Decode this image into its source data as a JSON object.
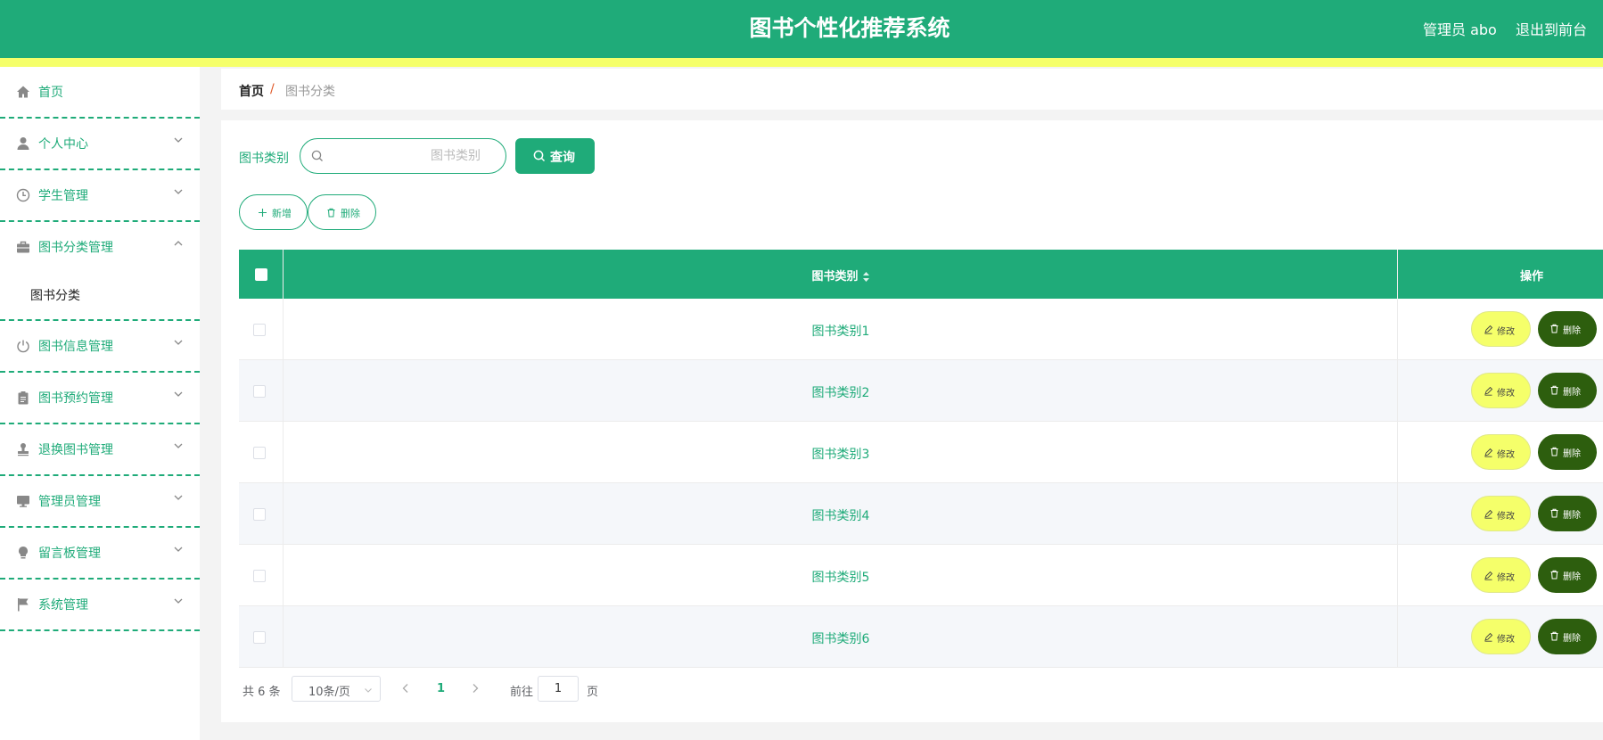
{
  "header": {
    "title": "图书个性化推荐系统",
    "user": "管理员 abo",
    "logout": "退出到前台"
  },
  "sidebar": {
    "items": [
      {
        "label": "首页",
        "icon": "home-icon"
      },
      {
        "label": "个人中心",
        "icon": "user-icon"
      },
      {
        "label": "学生管理",
        "icon": "clock-icon"
      },
      {
        "label": "图书分类管理",
        "icon": "briefcase-icon",
        "expanded": true,
        "children": [
          {
            "label": "图书分类"
          }
        ]
      },
      {
        "label": "图书信息管理",
        "icon": "power-icon"
      },
      {
        "label": "图书预约管理",
        "icon": "clipboard-icon"
      },
      {
        "label": "退换图书管理",
        "icon": "stamp-icon"
      },
      {
        "label": "管理员管理",
        "icon": "monitor-icon"
      },
      {
        "label": "留言板管理",
        "icon": "bulb-icon"
      },
      {
        "label": "系统管理",
        "icon": "flag-icon"
      }
    ]
  },
  "breadcrumb": {
    "home": "首页",
    "separator": "/",
    "current": "图书分类"
  },
  "search": {
    "label": "图书类别",
    "placeholder": "图书类别",
    "value": "",
    "button": "查询"
  },
  "actions": {
    "add": "新增",
    "delete": "删除"
  },
  "table": {
    "columns": [
      "图书类别",
      "操作"
    ],
    "rows": [
      "图书类别1",
      "图书类别2",
      "图书类别3",
      "图书类别4",
      "图书类别5",
      "图书类别6"
    ],
    "edit_label": "修改",
    "delete_label": "删除"
  },
  "pagination": {
    "total": "共 6 条",
    "page_size": "10条/页",
    "current_page": "1",
    "goto_label": "前往",
    "goto_value": "1",
    "page_label": "页"
  },
  "colors": {
    "primary": "#1fab79",
    "accent_yellow": "#f5ff6a",
    "delete_dark_green": "#2d5e0e"
  }
}
